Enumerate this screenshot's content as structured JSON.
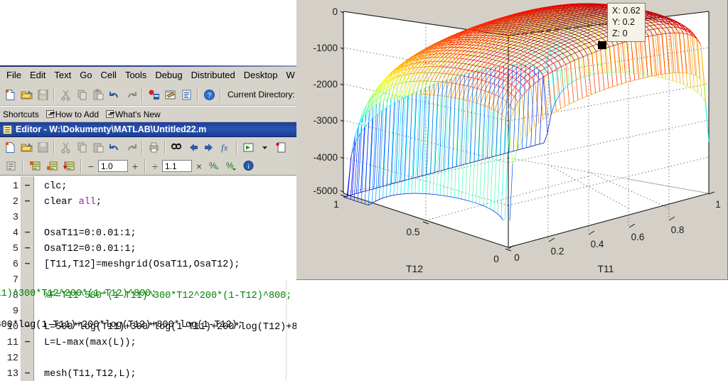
{
  "app": {
    "name": "MATLAB",
    "menu_items": [
      "File",
      "Edit",
      "Text",
      "Go",
      "Cell",
      "Tools",
      "Debug",
      "Distributed",
      "Desktop",
      "W"
    ],
    "current_directory_label": "Current Directory:"
  },
  "shortcuts_bar": {
    "label": "Shortcuts",
    "how_to_add": "How to Add",
    "whats_new": "What's New"
  },
  "toolbar": {
    "new_title": "New",
    "open_title": "Open",
    "save_title": "Save",
    "cut_title": "Cut",
    "copy_title": "Copy",
    "paste_title": "Paste",
    "undo_title": "Undo",
    "redo_title": "Redo",
    "simulink_title": "Simulink",
    "guide_title": "GUIDE",
    "profiler_title": "Profiler",
    "help_title": "Help"
  },
  "editor": {
    "title": "Editor - W:\\Dokumenty\\MATLAB\\Untitled22.m",
    "file_name": "Untitled22.m",
    "file_path": "W:\\Dokumenty\\MATLAB",
    "toolbar": {
      "new_title": "New",
      "open_title": "Open",
      "save_title": "Save",
      "cut_title": "Cut",
      "copy_title": "Copy",
      "paste_title": "Paste",
      "undo_title": "Undo",
      "redo_title": "Redo",
      "print_title": "Print",
      "find_title": "Find",
      "back_title": "Back",
      "forward_title": "Forward",
      "function_title": "Function Browser",
      "run_title": "Run",
      "stop_title": "Stop"
    },
    "cell_toolbar": {
      "decrease_label": "−",
      "increase_label": "+",
      "divide_label": "÷",
      "multiply_label": "×",
      "value_add": "1.0",
      "value_mult": "1.1"
    },
    "lines": [
      {
        "num": "1",
        "mark": "−",
        "segments": [
          {
            "t": "clc;",
            "c": "plain"
          }
        ]
      },
      {
        "num": "2",
        "mark": "−",
        "segments": [
          {
            "t": "clear ",
            "c": "plain"
          },
          {
            "t": "all",
            "c": "magenta"
          },
          {
            "t": ";",
            "c": "plain"
          }
        ]
      },
      {
        "num": "3",
        "mark": "",
        "segments": []
      },
      {
        "num": "4",
        "mark": "−",
        "segments": [
          {
            "t": "OsaT11=0:0.01:1;",
            "c": "plain"
          }
        ]
      },
      {
        "num": "5",
        "mark": "−",
        "segments": [
          {
            "t": "OsaT12=0:0.01:1;",
            "c": "plain"
          }
        ]
      },
      {
        "num": "6",
        "mark": "−",
        "segments": [
          {
            "t": "[T11,T12]=meshgrid(OsaT11,OsaT12);",
            "c": "plain"
          }
        ]
      },
      {
        "num": "7",
        "mark": "",
        "segments": []
      },
      {
        "num": "8",
        "mark": "",
        "segments": [
          {
            "t": "%F=T11^500*(1-T11)^300*T12^200*(1-T12)^800;",
            "c": "comment"
          }
        ]
      },
      {
        "num": "9",
        "mark": "",
        "segments": []
      },
      {
        "num": "10",
        "mark": "−",
        "segments": [
          {
            "t": "L=500*log(T11)+300*log(1-T11)+200*log(T12)+800*log(1-T12);",
            "c": "plain"
          }
        ]
      },
      {
        "num": "11",
        "mark": "−",
        "segments": [
          {
            "t": "L=L-max(max(L));",
            "c": "plain"
          }
        ]
      },
      {
        "num": "12",
        "mark": "",
        "segments": []
      },
      {
        "num": "13",
        "mark": "−",
        "segments": [
          {
            "t": "mesh(T11,T12,L);",
            "c": "plain"
          }
        ]
      }
    ]
  },
  "figure": {
    "data_tip": {
      "x_label": "X: 0.62",
      "y_label": "Y: 0.2",
      "z_label": "Z: 0"
    }
  },
  "chart_data": {
    "type": "surface",
    "title": "",
    "xlabel": "T11",
    "ylabel": "T12",
    "zlabel": "",
    "colormap": "jet",
    "mesh_style": "wireframe",
    "grid": true,
    "legend": null,
    "xticks": [
      "0",
      "0.2",
      "0.4",
      "0.6",
      "0.8",
      "1"
    ],
    "xtick_values": [
      0,
      0.2,
      0.4,
      0.6,
      0.8,
      1
    ],
    "yticks": [
      "0",
      "0.5",
      "1"
    ],
    "ytick_values": [
      0,
      0.5,
      1
    ],
    "zticks": [
      "0",
      "-1000",
      "-2000",
      "-3000",
      "-4000",
      "-5000"
    ],
    "ztick_values": [
      0,
      -1000,
      -2000,
      -3000,
      -4000,
      -5000
    ],
    "xlim": [
      0,
      1
    ],
    "ylim": [
      0,
      1
    ],
    "zlim": [
      -5000,
      0
    ],
    "expression": "L = 500*log(T11)+300*log(1-T11)+200*log(T12)+800*log(1-T12), normalized to max 0",
    "annotations": [
      {
        "kind": "datatip",
        "x": 0.62,
        "y": 0.2,
        "z": 0
      }
    ]
  }
}
